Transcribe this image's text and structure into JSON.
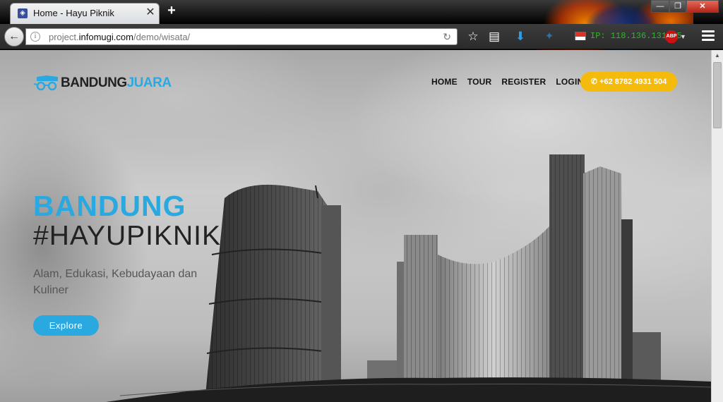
{
  "browser": {
    "tab_title": "Home - Hayu Piknik",
    "tab_close": "✕",
    "new_tab": "+",
    "window": {
      "minimize": "—",
      "maximize": "❐",
      "close": "✕"
    },
    "url": {
      "prefix": "project.",
      "domain": "infomugi.com",
      "path": "/demo/wisata/"
    },
    "ip_text": "IP: 118.136.131.45",
    "abp_label": "ABP"
  },
  "site": {
    "logo": {
      "part1": "BANDUNG",
      "part2": "JUARA"
    },
    "nav": [
      "HOME",
      "TOUR",
      "REGISTER",
      "LOGIN"
    ],
    "phone_button": "✆ +62 8782 4931 504",
    "hero": {
      "title": "BANDUNG",
      "subtitle": "#HAYUPIKNIK",
      "tagline": "Alam, Edukasi, Kebudayaan dan Kuliner",
      "button": "Explore"
    }
  },
  "colors": {
    "accent": "#2aa9e0",
    "phone_button": "#f4bb0c",
    "ip_text": "#2fb52f"
  },
  "icons": [
    "back-arrow-icon",
    "info-icon",
    "reload-icon",
    "star-icon",
    "reading-list-icon",
    "download-icon",
    "twitter-icon",
    "flag-icon",
    "adblock-icon",
    "menu-icon",
    "phone-icon"
  ]
}
